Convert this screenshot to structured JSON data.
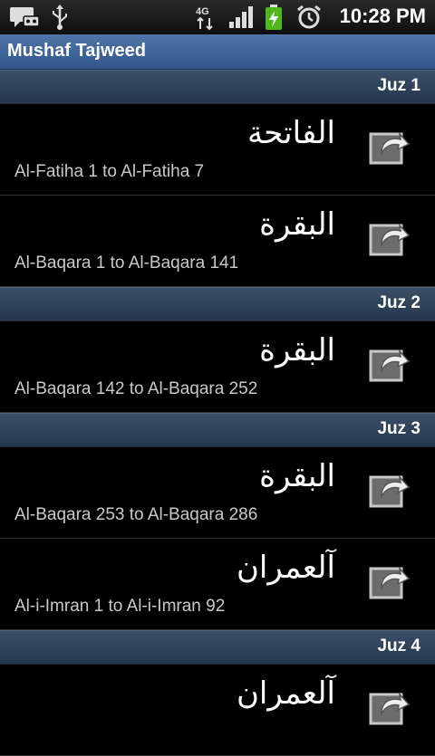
{
  "status": {
    "time": "10:28 PM",
    "network": "4G"
  },
  "app": {
    "title": "Mushaf Tajweed"
  },
  "sections": [
    {
      "header": "Juz 1",
      "items": [
        {
          "arabic": "الفاتحة",
          "range": "Al-Fatiha 1 to Al-Fatiha 7"
        },
        {
          "arabic": "البقرة",
          "range": "Al-Baqara 1 to Al-Baqara 141"
        }
      ]
    },
    {
      "header": "Juz 2",
      "items": [
        {
          "arabic": "البقرة",
          "range": "Al-Baqara 142 to Al-Baqara 252"
        }
      ]
    },
    {
      "header": "Juz 3",
      "items": [
        {
          "arabic": "البقرة",
          "range": "Al-Baqara 253 to Al-Baqara 286"
        },
        {
          "arabic": "آلعمران",
          "range": "Al-i-Imran 1 to Al-i-Imran 92"
        }
      ]
    },
    {
      "header": "Juz 4",
      "items": [
        {
          "arabic": "آلعمران",
          "range": ""
        }
      ]
    }
  ]
}
